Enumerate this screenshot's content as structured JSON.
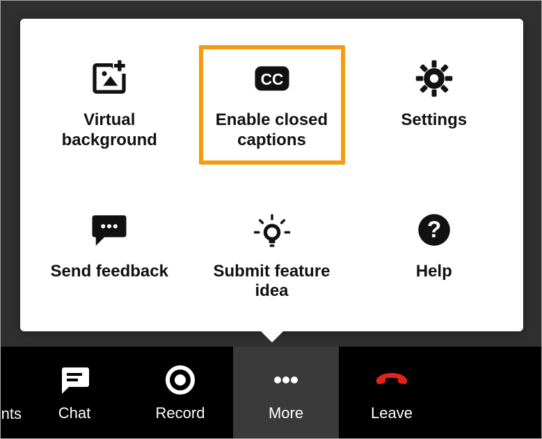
{
  "highlight_color": "#f59b13",
  "menu": {
    "items": [
      {
        "label": "Virtual background"
      },
      {
        "label": "Enable closed captions"
      },
      {
        "label": "Settings"
      },
      {
        "label": "Send feedback"
      },
      {
        "label": "Submit feature idea"
      },
      {
        "label": "Help"
      }
    ]
  },
  "toolbar": {
    "partial_label": "nts",
    "items": [
      {
        "label": "Chat"
      },
      {
        "label": "Record"
      },
      {
        "label": "More"
      },
      {
        "label": "Leave"
      }
    ]
  }
}
